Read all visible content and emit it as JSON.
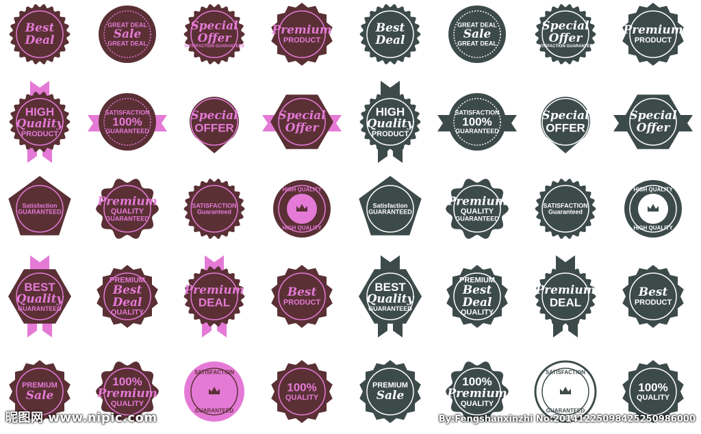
{
  "colors": {
    "brown": "#5a3035",
    "pink": "#e57ad6",
    "slate": "#3d4a4a",
    "white": "#ffffff"
  },
  "badges": [
    {
      "id": "r1c1",
      "theme": "brown",
      "shape": "scallop",
      "lines": [
        "Best",
        "Deal"
      ]
    },
    {
      "id": "r1c2",
      "theme": "brown",
      "shape": "circle",
      "lines": [
        "GREAT DEAL",
        "Sale",
        "GREAT DEAL"
      ]
    },
    {
      "id": "r1c3",
      "theme": "brown",
      "shape": "scallop",
      "lines": [
        "Special",
        "Offer",
        "SATISFACTION GUARANTEED"
      ]
    },
    {
      "id": "r1c4",
      "theme": "brown",
      "shape": "seal",
      "lines": [
        "Premium",
        "PRODUCT"
      ]
    },
    {
      "id": "r1c5",
      "theme": "slate",
      "shape": "scallop",
      "lines": [
        "Best",
        "Deal"
      ]
    },
    {
      "id": "r1c6",
      "theme": "slate",
      "shape": "circle",
      "lines": [
        "GREAT DEAL",
        "Sale",
        "GREAT DEAL"
      ]
    },
    {
      "id": "r1c7",
      "theme": "slate",
      "shape": "scallop",
      "lines": [
        "Special",
        "Offer",
        "SATISFACTION GUARANTEED"
      ]
    },
    {
      "id": "r1c8",
      "theme": "slate",
      "shape": "seal",
      "lines": [
        "Premium",
        "PRODUCT"
      ]
    },
    {
      "id": "r2c1",
      "theme": "brown",
      "shape": "scallop-ribbon",
      "lines": [
        "HIGH",
        "Quality",
        "PRODUCT"
      ]
    },
    {
      "id": "r2c2",
      "theme": "brown",
      "shape": "circle-banner",
      "lines": [
        "SATISFACTION",
        "100%",
        "GUARANTEED"
      ]
    },
    {
      "id": "r2c3",
      "theme": "brown",
      "shape": "pin",
      "lines": [
        "Special",
        "OFFER"
      ]
    },
    {
      "id": "r2c4",
      "theme": "brown",
      "shape": "hex-banner",
      "lines": [
        "Special",
        "Offer"
      ]
    },
    {
      "id": "r2c5",
      "theme": "slate",
      "shape": "scallop-ribbon",
      "lines": [
        "HIGH",
        "Quality",
        "PRODUCT"
      ]
    },
    {
      "id": "r2c6",
      "theme": "slate",
      "shape": "circle-banner",
      "lines": [
        "SATISFACTION",
        "100%",
        "GUARANTEED"
      ]
    },
    {
      "id": "r2c7",
      "theme": "slate",
      "shape": "pin",
      "lines": [
        "Special",
        "OFFER"
      ]
    },
    {
      "id": "r2c8",
      "theme": "slate",
      "shape": "hex-banner",
      "lines": [
        "Special",
        "Offer"
      ]
    },
    {
      "id": "r3c1",
      "theme": "brown",
      "shape": "pentagon",
      "lines": [
        "Satisfaction",
        "GUARANTEED"
      ]
    },
    {
      "id": "r3c2",
      "theme": "brown",
      "shape": "wavy",
      "lines": [
        "Premium",
        "QUALITY",
        "GUARANTEED"
      ]
    },
    {
      "id": "r3c3",
      "theme": "brown",
      "shape": "scallop",
      "lines": [
        "SATISFACTION",
        "Guaranteed"
      ]
    },
    {
      "id": "r3c4",
      "theme": "brown",
      "shape": "circle-crown",
      "lines": [
        "HIGH QUALITY",
        "HIGH QUALITY"
      ]
    },
    {
      "id": "r3c5",
      "theme": "slate",
      "shape": "pentagon",
      "lines": [
        "Satisfaction",
        "GUARANTEED"
      ]
    },
    {
      "id": "r3c6",
      "theme": "slate",
      "shape": "wavy",
      "lines": [
        "Premium",
        "QUALITY",
        "GUARANTEED"
      ]
    },
    {
      "id": "r3c7",
      "theme": "slate",
      "shape": "scallop",
      "lines": [
        "SATISFACTION",
        "Guaranteed"
      ]
    },
    {
      "id": "r3c8",
      "theme": "slate",
      "shape": "circle-crown",
      "lines": [
        "HIGH QUALITY",
        "HIGH QUALITY"
      ]
    },
    {
      "id": "r4c1",
      "theme": "brown",
      "shape": "hex-ribbon",
      "lines": [
        "BEST",
        "Quality",
        "GUARANTEED"
      ]
    },
    {
      "id": "r4c2",
      "theme": "brown",
      "shape": "seal",
      "lines": [
        "PREMIUM",
        "Best",
        "Deal",
        "QUALITY"
      ]
    },
    {
      "id": "r4c3",
      "theme": "brown",
      "shape": "scallop-ribbon",
      "lines": [
        "Premium",
        "DEAL"
      ]
    },
    {
      "id": "r4c4",
      "theme": "brown",
      "shape": "seal",
      "lines": [
        "Best",
        "PRODUCT"
      ]
    },
    {
      "id": "r4c5",
      "theme": "slate",
      "shape": "hex-ribbon",
      "lines": [
        "BEST",
        "Quality",
        "GUARANTEED"
      ]
    },
    {
      "id": "r4c6",
      "theme": "slate",
      "shape": "seal",
      "lines": [
        "PREMIUM",
        "Best",
        "Deal",
        "QUALITY"
      ]
    },
    {
      "id": "r4c7",
      "theme": "slate",
      "shape": "scallop-ribbon",
      "lines": [
        "Premium",
        "DEAL"
      ]
    },
    {
      "id": "r4c8",
      "theme": "slate",
      "shape": "seal",
      "lines": [
        "Best",
        "PRODUCT"
      ]
    },
    {
      "id": "r5c1",
      "theme": "brown",
      "shape": "seal",
      "lines": [
        "PREMIUM",
        "Sale"
      ]
    },
    {
      "id": "r5c2",
      "theme": "brown",
      "shape": "wavy",
      "lines": [
        "100%",
        "Premium",
        "QUALITY"
      ]
    },
    {
      "id": "r5c3",
      "theme": "brown",
      "shape": "circle-crown-pink",
      "lines": [
        "SATISFACTION",
        "GUARANTEED"
      ]
    },
    {
      "id": "r5c4",
      "theme": "brown",
      "shape": "seal",
      "lines": [
        "100%",
        "QUALITY"
      ]
    },
    {
      "id": "r5c5",
      "theme": "slate",
      "shape": "seal",
      "lines": [
        "PREMIUM",
        "Sale"
      ]
    },
    {
      "id": "r5c6",
      "theme": "slate",
      "shape": "wavy",
      "lines": [
        "100%",
        "Premium",
        "QUALITY"
      ]
    },
    {
      "id": "r5c7",
      "theme": "slate",
      "shape": "circle-crown-white",
      "lines": [
        "SATISFACTION",
        "GUARANTEED"
      ]
    },
    {
      "id": "r5c8",
      "theme": "slate",
      "shape": "seal",
      "lines": [
        "100%",
        "QUALITY"
      ]
    }
  ],
  "watermark_left": "昵图网 www.nipic.com",
  "watermark_right": "By:Fengshanxinzhi No:20141225098425250986000"
}
